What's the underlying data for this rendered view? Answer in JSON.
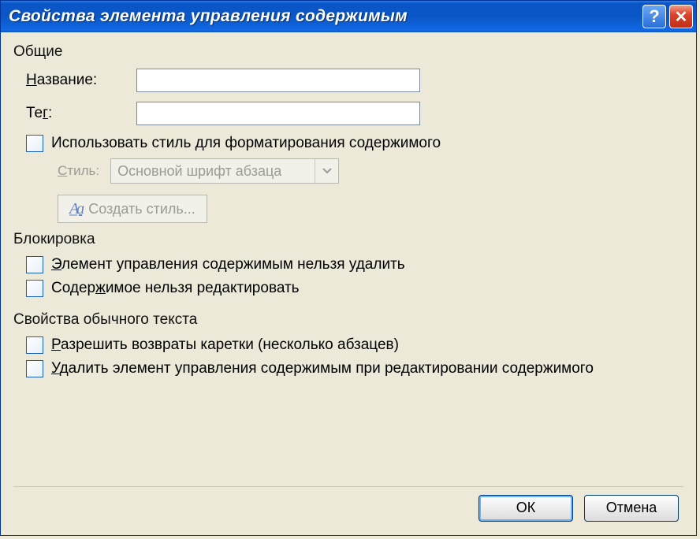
{
  "window": {
    "title": "Свойства элемента управления содержимым"
  },
  "sections": {
    "general": {
      "title": "Общие",
      "name_label": "Название:",
      "name_value": "",
      "tag_label": "Тег:",
      "tag_value": "",
      "use_style_label": "Использовать стиль для форматирования содержимого",
      "style_label": "Стиль:",
      "style_value": "Основной шрифт абзаца",
      "create_style_label": "Создать стиль..."
    },
    "locking": {
      "title": "Блокировка",
      "cannot_delete_label": "Элемент управления содержимым нельзя удалить",
      "cannot_edit_label": "Содержимое нельзя редактировать"
    },
    "plaintext": {
      "title": "Свойства обычного текста",
      "allow_cr_label": "Разрешить возвраты каретки (несколько абзацев)",
      "remove_on_edit_label": "Удалить элемент управления содержимым при редактировании содержимого"
    }
  },
  "buttons": {
    "ok": "ОК",
    "cancel": "Отмена"
  }
}
